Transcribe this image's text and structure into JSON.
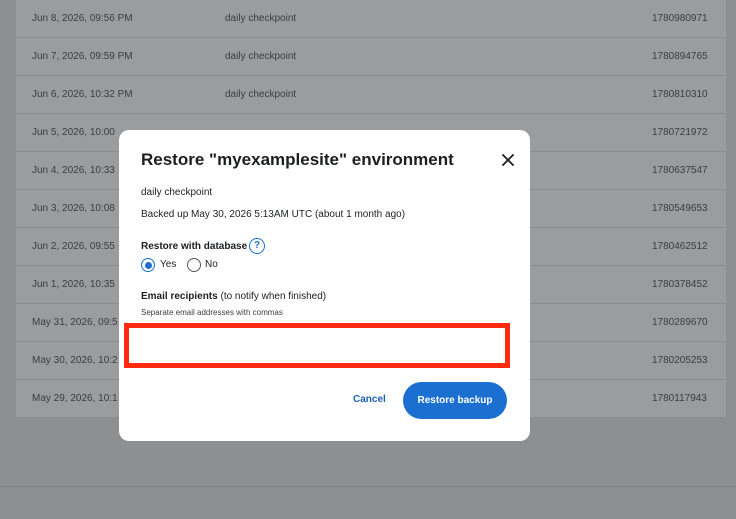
{
  "backups": [
    {
      "date": "Jun 8, 2026, 09:56 PM",
      "name": "daily checkpoint",
      "id": "1780980971"
    },
    {
      "date": "Jun 7, 2026, 09:59 PM",
      "name": "daily checkpoint",
      "id": "1780894765"
    },
    {
      "date": "Jun 6, 2026, 10:32 PM",
      "name": "daily checkpoint",
      "id": "1780810310"
    },
    {
      "date": "Jun 5, 2026, 10:00",
      "name": "",
      "id": "1780721972"
    },
    {
      "date": "Jun 4, 2026, 10:33",
      "name": "",
      "id": "1780637547"
    },
    {
      "date": "Jun 3, 2026, 10:08",
      "name": "",
      "id": "1780549653"
    },
    {
      "date": "Jun 2, 2026, 09:55",
      "name": "",
      "id": "1780462512"
    },
    {
      "date": "Jun 1, 2026, 10:35",
      "name": "",
      "id": "1780378452"
    },
    {
      "date": "May 31, 2026, 09:5",
      "name": "",
      "id": "1780289670"
    },
    {
      "date": "May 30, 2026, 10:2",
      "name": "",
      "id": "1780205253"
    },
    {
      "date": "May 29, 2026, 10:1",
      "name": "",
      "id": "1780117943"
    }
  ],
  "modal": {
    "title": "Restore \"myexamplesite\" environment",
    "backup_name": "daily checkpoint",
    "backed_up": "Backed up May 30, 2026 5:13AM UTC (about 1 month ago)",
    "restore_with_database_label": "Restore with database",
    "help_icon_glyph": "?",
    "yes_label": "Yes",
    "no_label": "No",
    "selected_option": "Yes",
    "email_label": "Email recipients",
    "email_label_suffix": "(to notify when finished)",
    "email_hint": "Separate email addresses with commas",
    "email_value": "",
    "cancel_label": "Cancel",
    "restore_label": "Restore backup"
  },
  "colors": {
    "accent": "#1a6fd0",
    "highlight_border": "#ff2a0f",
    "overlay": "#8d8f91"
  }
}
